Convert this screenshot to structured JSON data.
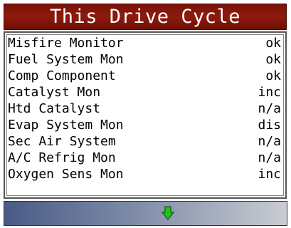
{
  "header": {
    "title": "This Drive Cycle"
  },
  "monitors": [
    {
      "name": "Misfire Monitor",
      "status": "ok"
    },
    {
      "name": "Fuel System Mon",
      "status": "ok"
    },
    {
      "name": "Comp Component",
      "status": "ok"
    },
    {
      "name": "Catalyst Mon",
      "status": "inc"
    },
    {
      "name": "Htd Catalyst",
      "status": "n/a"
    },
    {
      "name": "Evap System Mon",
      "status": "dis"
    },
    {
      "name": "Sec Air System",
      "status": "n/a"
    },
    {
      "name": "A/C Refrig Mon",
      "status": "n/a"
    },
    {
      "name": "Oxygen Sens Mon",
      "status": "inc"
    }
  ],
  "footer": {
    "scroll_icon": "green-down-arrow-icon"
  },
  "colors": {
    "title_bg": "#8e1a0d",
    "arrow": "#22c41a"
  }
}
